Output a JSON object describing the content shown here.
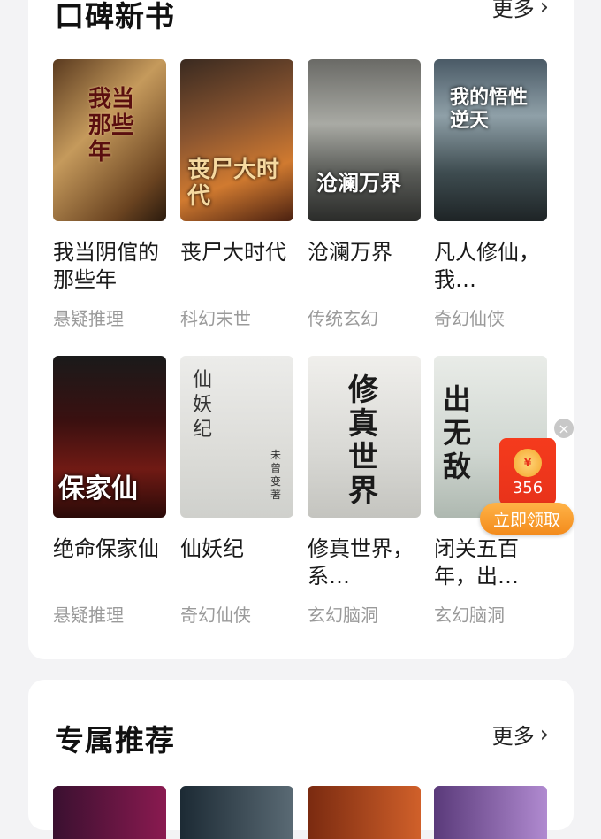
{
  "section1": {
    "title": "口碑新书",
    "more": "更多",
    "books": [
      {
        "title": "我当阴倌的那些年",
        "genre": "悬疑推理",
        "cover_text": "我当那些年"
      },
      {
        "title": "丧尸大时代",
        "genre": "科幻末世",
        "cover_text": "丧尸大时代"
      },
      {
        "title": "沧澜万界",
        "genre": "传统玄幻",
        "cover_text": "沧澜万界"
      },
      {
        "title": "凡人修仙，我…",
        "genre": "奇幻仙侠",
        "cover_text": "我的悟性逆天"
      },
      {
        "title": "绝命保家仙",
        "genre": "悬疑推理",
        "cover_text": "保家仙"
      },
      {
        "title": "仙妖纪",
        "genre": "奇幻仙侠",
        "cover_text": "仙妖纪",
        "cover_author": "未曾变 著"
      },
      {
        "title": "修真世界，系…",
        "genre": "玄幻脑洞",
        "cover_text": "修真世界"
      },
      {
        "title": "闭关五百年，出…",
        "genre": "玄幻脑洞",
        "cover_text": "出无敌"
      }
    ]
  },
  "section2": {
    "title": "专属推荐",
    "more": "更多"
  },
  "red_packet": {
    "amount": "356",
    "claim_label": "立即领取",
    "coin_glyph": "¥"
  }
}
